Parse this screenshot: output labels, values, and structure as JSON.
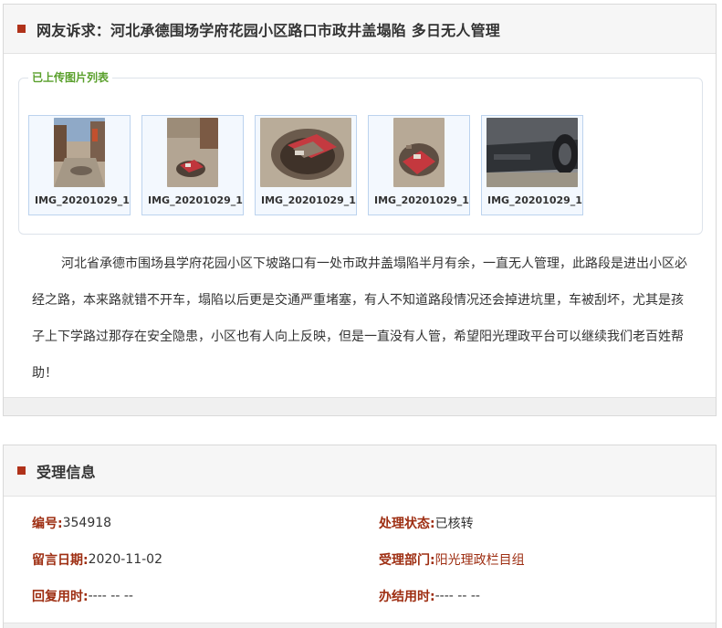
{
  "complaint": {
    "title": "网友诉求：河北承德围场学府花园小区路口市政井盖塌陷 多日无人管理",
    "images_legend": "已上传图片列表",
    "images": [
      {
        "label": "IMG_20201029_1"
      },
      {
        "label": "IMG_20201029_1"
      },
      {
        "label": "IMG_20201029_1"
      },
      {
        "label": "IMG_20201029_1"
      },
      {
        "label": "IMG_20201029_1"
      }
    ],
    "content": "河北省承德市围场县学府花园小区下坡路口有一处市政井盖塌陷半月有余，一直无人管理，此路段是进出小区必经之路，本来路就错不开车，塌陷以后更是交通严重堵塞，有人不知道路段情况还会掉进坑里，车被刮坏，尤其是孩子上下学路过那存在安全隐患，小区也有人向上反映，但是一直没有人管，希望阳光理政平台可以继续我们老百姓帮助！"
  },
  "acceptance": {
    "title": "受理信息",
    "fields": {
      "number_label": "编号:",
      "number_value": "354918",
      "status_label": "处理状态:",
      "status_value": "已核转",
      "date_label": "留言日期:",
      "date_value": "2020-11-02",
      "dept_label": "受理部门:",
      "dept_value": "阳光理政栏目组",
      "reply_label": "回复用时:",
      "reply_value": "---- -- --",
      "finish_label": "办结用时:",
      "finish_value": "---- -- --"
    }
  }
}
